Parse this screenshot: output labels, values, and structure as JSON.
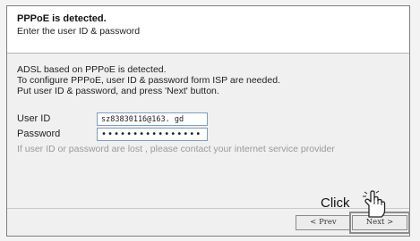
{
  "header": {
    "title": "PPPoE is detected.",
    "subtitle": "Enter the user ID & password"
  },
  "info": {
    "line1": "ADSL based on PPPoE is detected.",
    "line2": "To configure PPPoE, user ID & password form ISP are needed.",
    "line3": "Put user ID & password, and press 'Next' button."
  },
  "form": {
    "user_id_label": "User ID",
    "user_id_value": "sz83830116@163. gd",
    "password_label": "Password",
    "password_value": "••••••••••••••••",
    "note": "If user ID or password are lost , please contact your internet service provider"
  },
  "buttons": {
    "prev_label": "< Prev",
    "next_label": "Next >"
  },
  "overlay": {
    "click_label": "Click",
    "hand_icon": "pointing-hand-icon"
  }
}
